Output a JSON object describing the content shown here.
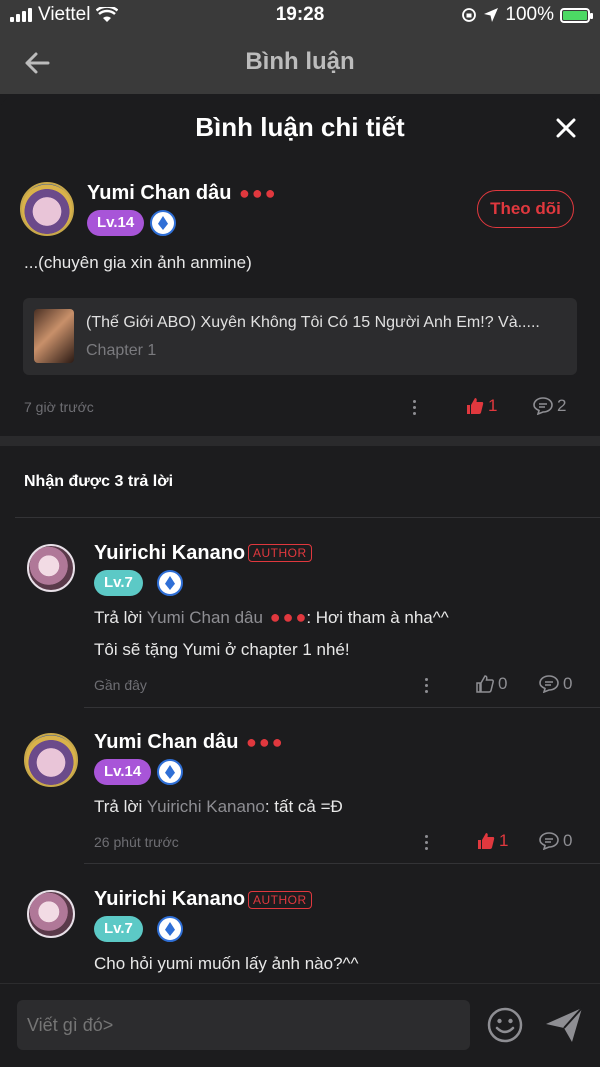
{
  "status_bar": {
    "carrier": "Viettel",
    "time": "19:28",
    "battery": "100%"
  },
  "nav": {
    "title": "Bình luận"
  },
  "sheet": {
    "title": "Bình luận chi tiết"
  },
  "main_comment": {
    "user": "Yumi Chan dâu",
    "level": "Lv.14",
    "follow_label": "Theo dõi",
    "text": "...(chuyên gia xin ảnh anmine)",
    "chapter_title": "(Thế Giới ABO) Xuyên Không Tôi Có 15 Người Anh Em!? Và.....",
    "chapter_sub": "Chapter 1",
    "time": "7 giờ trước",
    "likes": "1",
    "comments": "2"
  },
  "replies_header": "Nhận được 3 trả lời",
  "reply_prefix": "Trả lời",
  "replies": [
    {
      "user": "Yuirichi Kanano",
      "badge": "AUTHOR",
      "level": "Lv.7",
      "reply_to": "Yumi Chan dâu",
      "text": ": Hơi tham à nha^^",
      "text2": "Tôi sẽ tặng Yumi ở chapter 1 nhé!",
      "time": "Gần đây",
      "likes": "0",
      "comments": "0"
    },
    {
      "user": "Yumi Chan dâu",
      "level": "Lv.14",
      "reply_to": "Yuirichi Kanano",
      "text": ": tất cả =Đ",
      "time": "26 phút trước",
      "likes": "1",
      "comments": "0"
    },
    {
      "user": "Yuirichi Kanano",
      "badge": "AUTHOR",
      "level": "Lv.7",
      "text": "Cho hỏi yumi muốn lấy ảnh nào?^^"
    }
  ],
  "input": {
    "placeholder": "Viết gì đó>"
  },
  "colors": {
    "accent": "#e0383e",
    "lv_purple": "#a855d8",
    "lv_teal": "#5cc9c6",
    "background": "#1c1c1e"
  }
}
